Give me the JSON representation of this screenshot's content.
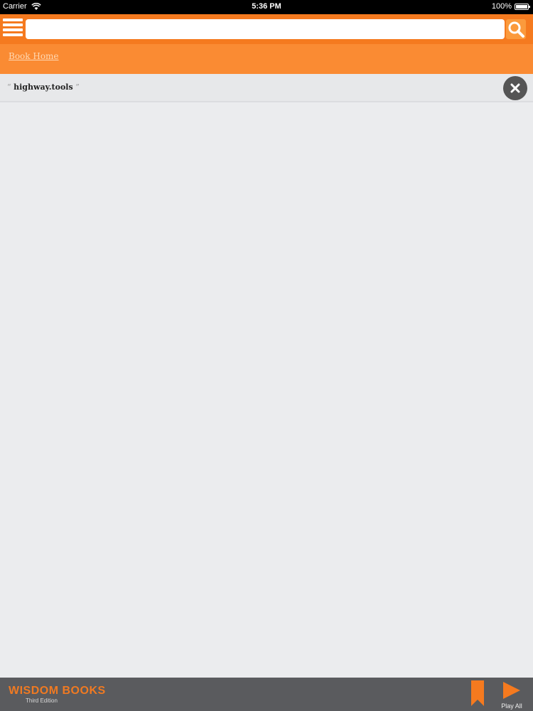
{
  "status_bar": {
    "carrier": "Carrier",
    "time": "5:36 PM",
    "battery_text": "100%",
    "battery_level": 1.0
  },
  "toolbar": {
    "menu_icon": "hamburger-menu-icon",
    "search_value": "",
    "search_icon": "magnifier-icon"
  },
  "breadcrumb": {
    "label": "Book Home"
  },
  "results": [
    {
      "open_quote": "“",
      "term": "highway.tools",
      "close_quote": "”"
    }
  ],
  "bottom_bar": {
    "logo_title": "WISDOM BOOKS",
    "logo_subtitle": "Third Edition",
    "play_label": "Play All"
  },
  "colors": {
    "brand_orange": "#f57a1f",
    "breadcrumb_orange": "#fa8b33",
    "background": "#ebecee",
    "bottom_bar": "#5a5b5e",
    "close_button": "#555555"
  }
}
